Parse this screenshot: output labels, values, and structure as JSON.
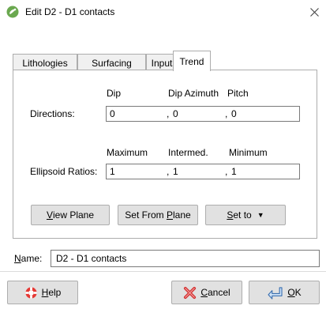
{
  "window": {
    "title": "Edit D2 - D1 contacts",
    "close_icon": "close-icon",
    "app_icon": "leapfrog-app-icon"
  },
  "tabs": [
    {
      "label": "Lithologies",
      "active": false
    },
    {
      "label": "Surfacing",
      "active": false
    },
    {
      "label": "Inputs",
      "active": false
    },
    {
      "label": "Trend",
      "active": true
    }
  ],
  "directions": {
    "label": "Directions:",
    "headers": [
      "Dip",
      "Dip Azimuth",
      "Pitch"
    ],
    "values": [
      "0",
      "0",
      "0"
    ],
    "separator": ","
  },
  "ellipsoid": {
    "label": "Ellipsoid Ratios:",
    "headers": [
      "Maximum",
      "Intermed.",
      "Minimum"
    ],
    "values": [
      "1",
      "1",
      "1"
    ],
    "separator": ","
  },
  "buttons": {
    "view_plane": {
      "prefix": "",
      "mnemonic": "V",
      "rest": "iew Plane"
    },
    "set_from_plane": {
      "prefix": "Set From ",
      "mnemonic": "P",
      "rest": "lane"
    },
    "set_to": {
      "prefix": "",
      "mnemonic": "S",
      "rest": "et to",
      "arrow": "▼"
    },
    "help": {
      "prefix": "",
      "mnemonic": "H",
      "rest": "elp",
      "icon": "lifebuoy-icon"
    },
    "cancel": {
      "prefix": "",
      "mnemonic": "C",
      "rest": "ancel",
      "icon": "cross-icon"
    },
    "ok": {
      "prefix": "",
      "mnemonic": "O",
      "rest": "K",
      "icon": "ok-arrow-icon"
    }
  },
  "name": {
    "label_mnemonic": "N",
    "label_rest": "ame:",
    "value": "D2 - D1 contacts"
  }
}
